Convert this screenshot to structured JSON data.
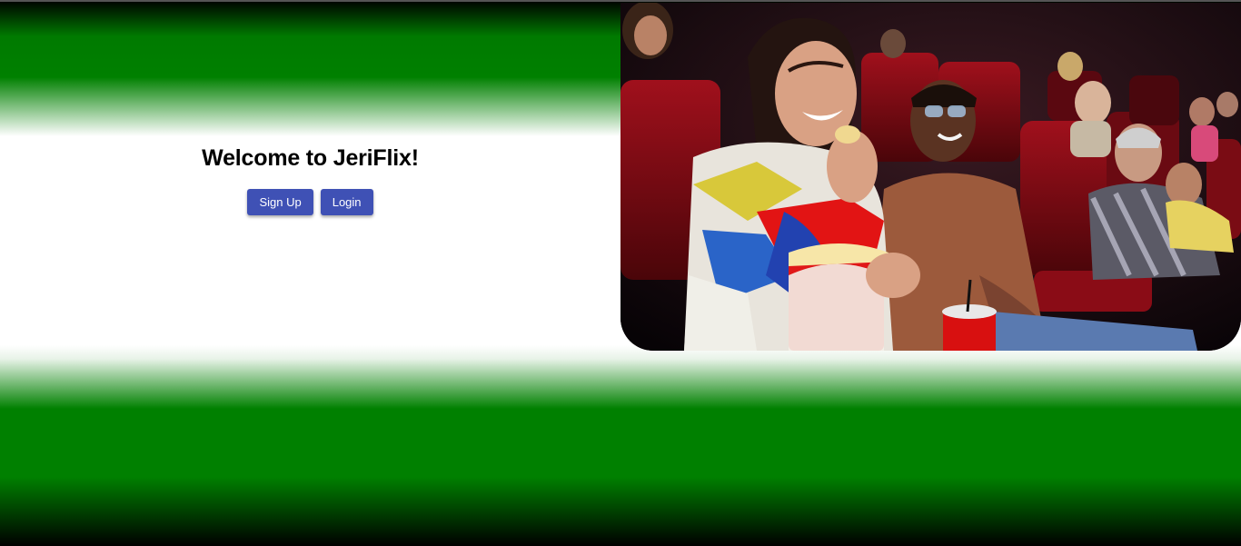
{
  "welcome": {
    "title": "Welcome to JeriFlix!",
    "signup_label": "Sign Up",
    "login_label": "Login"
  },
  "colors": {
    "brand_green": "#008000",
    "button_blue": "#3f51b5"
  },
  "hero_image": {
    "subject": "audience in a movie theater eating popcorn"
  }
}
